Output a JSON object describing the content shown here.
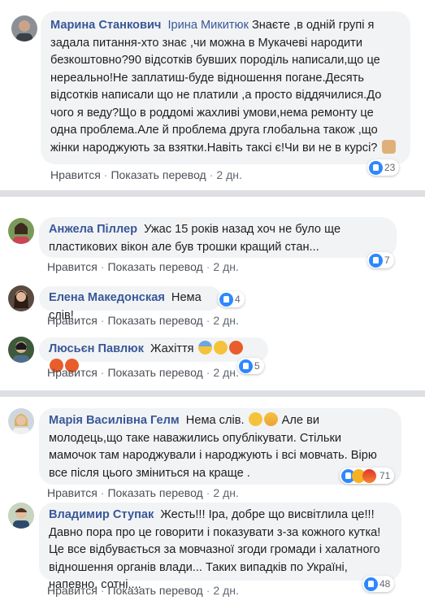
{
  "comments": [
    {
      "author": "Марина Станкович",
      "mention": "Ірина Микитюк",
      "text": "Знаєте ,в одній групі я задала питання-хто знає ,чи можна в Мукачеві народити безкоштовно?90 відсотків бувших породіль написали,що це нереально!Не заплатиш-буде відношення погане.Десять відсотків написали що не платили ,а просто віддячилися.До чого я веду?Що в роддомі жахливі умови,нема ремонту це одна проблема.Але й проблема друга глобальна також ,що жінки народжують за взятки.Навіть таксі є!Чи ви не в курсі?",
      "like": "Нравится",
      "translate": "Показать перевод",
      "time": "2 дн.",
      "reactions": "23"
    },
    {
      "author": "Анжела Піллер",
      "text": "Ужас 15 років назад хоч не було ще пластикових вікон але був трошки кращий стан...",
      "like": "Нравится",
      "translate": "Показать перевод",
      "time": "2 дн.",
      "reactions": "7"
    },
    {
      "author": "Елена Македонская",
      "text": "Нема слів!",
      "like": "Нравится",
      "translate": "Показать перевод",
      "time": "2 дн.",
      "reactions": "4"
    },
    {
      "author": "Люсьєн Павлюк",
      "text": "Жахіття",
      "like": "Нравится",
      "translate": "Показать перевод",
      "time": "2 дн.",
      "reactions": "5"
    },
    {
      "author": "Марія Василівна Гелм",
      "text_a": "Нема слів.",
      "text_b": "Але ви молодець,що таке наважились опублікувати. Стільки мамочок там народжували і народжують і всі мовчать. Вірю все після цього зміниться на краще .",
      "like": "Нравится",
      "translate": "Показать перевод",
      "time": "2 дн.",
      "reactions": "71"
    },
    {
      "author": "Владимир Ступак",
      "text": "Жесть!!! Іра, добре що висвітлила це!!! Давно пора про це говорити і показувати з-за кожного кутка! Це все відбувається за мовчазної згоди громади і халатного відношення органів влади... Таких випадків по Україні, напевно, сотні....",
      "like": "Нравится",
      "translate": "Показать перевод",
      "time": "2 дн.",
      "reactions": "48"
    }
  ],
  "colors": {
    "link": "#385898",
    "bubble": "#f2f3f5",
    "like": "#2d88ff"
  }
}
